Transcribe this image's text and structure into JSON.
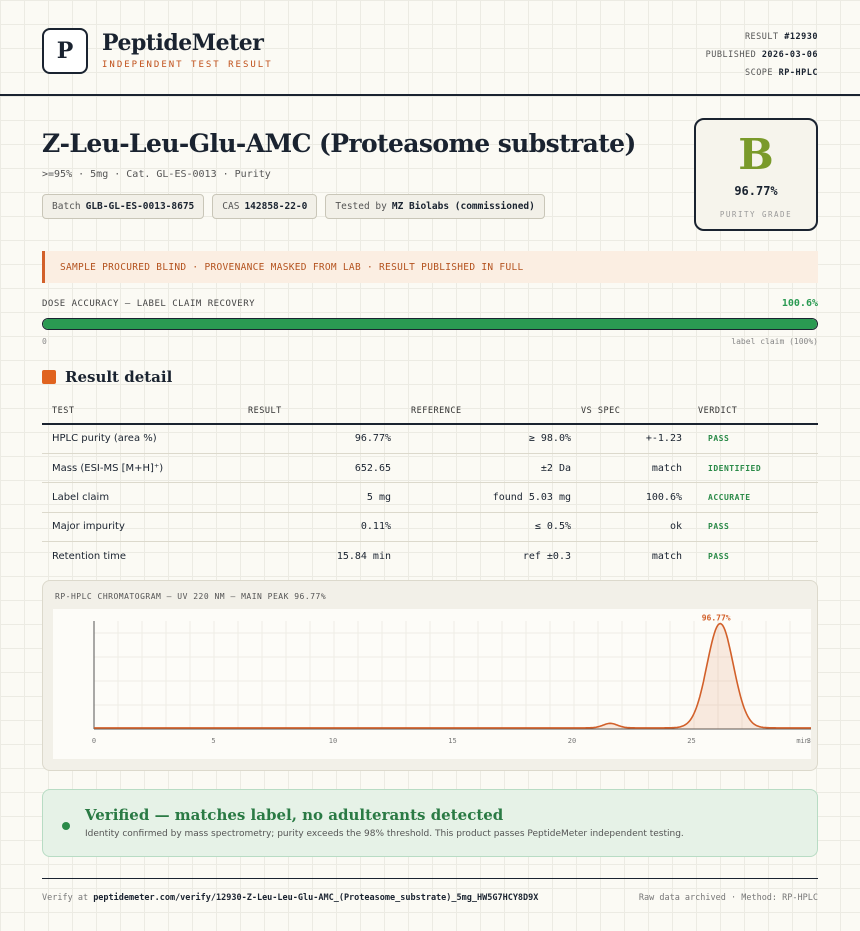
{
  "header": {
    "logo_letter": "P",
    "brand": "PeptideMeter",
    "tagline": "INDEPENDENT TEST RESULT",
    "result_label": "RESULT",
    "result_id": "#12930",
    "published_label": "PUBLISHED",
    "published_date": "2026-03-06",
    "scope_label": "SCOPE",
    "scope_value": "RP-HPLC"
  },
  "product": {
    "title": "Z-Leu-Leu-Glu-AMC (Proteasome substrate)",
    "subline": ">=95% · 5mg · Cat. GL-ES-0013 · Purity",
    "batch_label": "Batch",
    "batch": "GLB-GL-ES-0013-8675",
    "cas_label": "CAS",
    "cas": "142858-22-0",
    "tested_label": "Tested by",
    "tested": "MZ Biolabs (commissioned)"
  },
  "grade": {
    "letter": "B",
    "value": "96.77%",
    "label": "PURITY GRADE",
    "color": "#7a9a2a"
  },
  "notice": "SAMPLE PROCURED BLIND · PROVENANCE MASKED FROM LAB · RESULT PUBLISHED IN FULL",
  "dose": {
    "label": "DOSE ACCURACY — LABEL CLAIM RECOVERY",
    "value": "100.6%",
    "fill_fraction": 1.0,
    "min_label": "0",
    "max_label": "label claim (100%)"
  },
  "results": {
    "section_title": "Result detail",
    "columns": [
      "TEST",
      "RESULT",
      "REFERENCE",
      "VS SPEC",
      "VERDICT"
    ],
    "rows": [
      {
        "test": "HPLC purity (area %)",
        "result": "96.77%",
        "reference": "≥ 98.0%",
        "vs_spec": "+-1.23",
        "verdict": "PASS"
      },
      {
        "test": "Mass (ESI-MS [M+H]⁺)",
        "result": "652.65",
        "reference": "±2 Da",
        "vs_spec": "match",
        "verdict": "IDENTIFIED"
      },
      {
        "test": "Label claim",
        "result": "5 mg",
        "reference": "found 5.03 mg",
        "vs_spec": "100.6%",
        "verdict": "ACCURATE"
      },
      {
        "test": "Major impurity",
        "result": "0.11%",
        "reference": "≤ 0.5%",
        "vs_spec": "ok",
        "verdict": "PASS"
      },
      {
        "test": "Retention time",
        "result": "15.84 min",
        "reference": "ref ±0.3",
        "vs_spec": "match",
        "verdict": "PASS"
      }
    ]
  },
  "chart_data": {
    "type": "line",
    "title": "RP-HPLC CHROMATOGRAM — UV 220 NM — MAIN PEAK 96.77%",
    "xlabel": "min",
    "ylabel": "",
    "xlim": [
      0,
      30
    ],
    "x_ticks": [
      "0",
      "5",
      "10",
      "15",
      "20",
      "25",
      "30"
    ],
    "grid": true,
    "series": [
      {
        "baseline": 0.01,
        "peaks": [
          {
            "center": 21.6,
            "height": 0.04,
            "width": 0.3
          },
          {
            "center": 26.2,
            "height": 0.92,
            "width": 0.55
          }
        ]
      }
    ],
    "annotation": {
      "x": 26.2,
      "text": "96.77%"
    },
    "color": "#d2602a"
  },
  "verified": {
    "title": "Verified — matches label, no adulterants detected",
    "subtitle": "Identity confirmed by mass spectrometry; purity exceeds the 98% threshold. This product passes PeptideMeter independent testing."
  },
  "footer": {
    "verify_label": "Verify at",
    "verify_url": "peptidemeter.com/verify/12930-Z-Leu-Leu-Glu-AMC_(Proteasome_substrate)_5mg_HW5G7HCY8D9X",
    "right": "Raw data archived · Method: RP-HPLC"
  }
}
